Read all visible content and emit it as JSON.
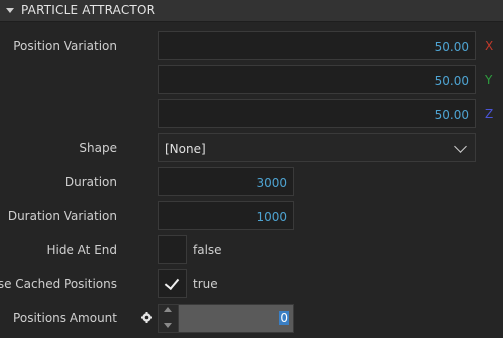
{
  "panel": {
    "title": "PARTICLE ATTRACTOR"
  },
  "position_variation": {
    "label": "Position Variation",
    "x": {
      "value": "50.00",
      "axis": "X",
      "color": "#c0392b"
    },
    "y": {
      "value": "50.00",
      "axis": "Y",
      "color": "#2e9e3e"
    },
    "z": {
      "value": "50.00",
      "axis": "Z",
      "color": "#4a54d6"
    }
  },
  "shape": {
    "label": "Shape",
    "value": "[None]"
  },
  "duration": {
    "label": "Duration",
    "value": "3000"
  },
  "duration_variation": {
    "label": "Duration Variation",
    "value": "1000"
  },
  "hide_at_end": {
    "label": "Hide At End",
    "checked": false,
    "value": "false"
  },
  "use_cached_positions": {
    "label": "Use Cached Positions",
    "checked": true,
    "value": "true"
  },
  "positions_amount": {
    "label": "Positions Amount",
    "value": "0"
  }
}
